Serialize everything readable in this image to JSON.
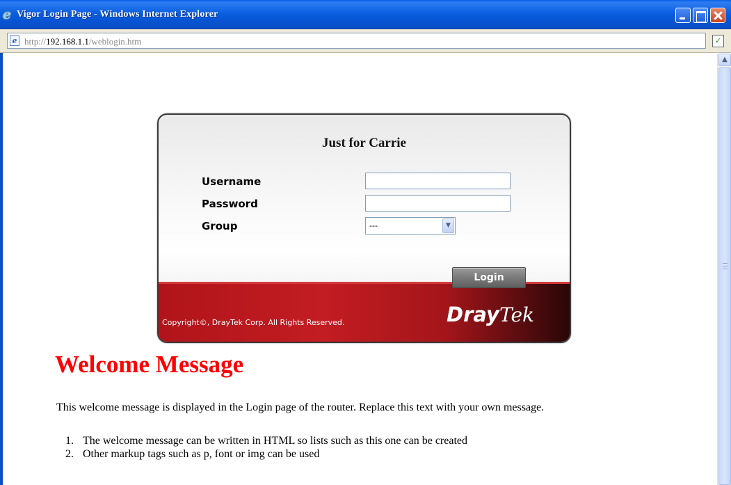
{
  "window": {
    "title": "Vigor Login Page - Windows Internet Explorer",
    "icon": "ie-logo-icon"
  },
  "address_bar": {
    "url_prefix": "http://",
    "url_host": "192.168.1.1",
    "url_path": "/weblogin.htm",
    "page_icon": "ie-page-icon",
    "security_icon": "certificate-icon"
  },
  "login": {
    "title": "Just for Carrie",
    "username_label": "Username",
    "password_label": "Password",
    "group_label": "Group",
    "username_value": "",
    "password_value": "",
    "group_selected": "---",
    "login_button": "Login",
    "copyright": "Copyright©, DrayTek Corp. All Rights Reserved.",
    "brand_bold": "Dray",
    "brand_italic": "Tek"
  },
  "welcome": {
    "title": "Welcome Message",
    "text": "This welcome message is displayed in the Login page of the router. Replace this text with your own message.",
    "items": [
      {
        "num": "1.",
        "text": "The welcome message can be written in HTML so lists such as this one can be created"
      },
      {
        "num": "2.",
        "text": "Other markup tags such as p, font or img can be used"
      }
    ]
  },
  "colors": {
    "titlebar": "#0753d3",
    "red_band": "#b0141a",
    "welcome_title": "#ff0000"
  }
}
